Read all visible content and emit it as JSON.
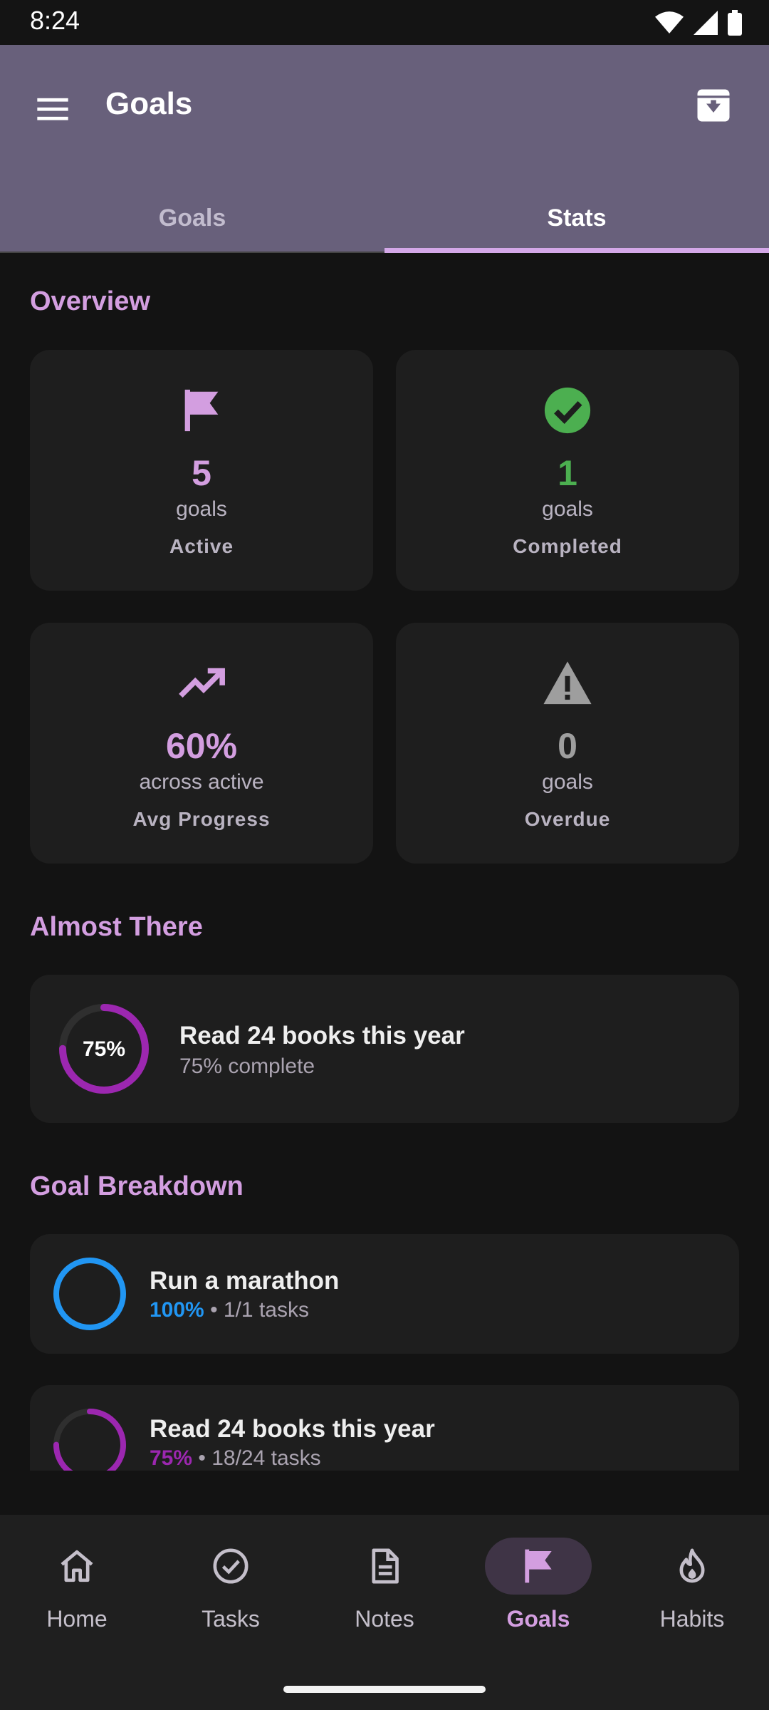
{
  "status": {
    "time": "8:24"
  },
  "appbar": {
    "title": "Goals"
  },
  "tabs": [
    {
      "label": "Goals"
    },
    {
      "label": "Stats"
    }
  ],
  "overview": {
    "title": "Overview",
    "cards": [
      {
        "value": "5",
        "unit": "goals",
        "caption": "Active",
        "icon": "flag-icon",
        "color": "#d39ee0"
      },
      {
        "value": "1",
        "unit": "goals",
        "caption": "Completed",
        "icon": "check-circle-icon",
        "color": "#4caf50"
      },
      {
        "value": "60%",
        "unit": "across active",
        "caption": "Avg Progress",
        "icon": "trending-up-icon",
        "color": "#d39ee0"
      },
      {
        "value": "0",
        "unit": "goals",
        "caption": "Overdue",
        "icon": "warning-icon",
        "color": "#9e9e9e"
      }
    ]
  },
  "almost_there": {
    "title": "Almost There",
    "item": {
      "percent_label": "75%",
      "progress": 0.75,
      "title": "Read 24 books this year",
      "subtitle": "75% complete",
      "color": "#9c27b0"
    }
  },
  "breakdown": {
    "title": "Goal Breakdown",
    "items": [
      {
        "title": "Run a marathon",
        "percent": "100%",
        "tasks": " • 1/1 tasks",
        "progress": 1.0,
        "color": "#2196f3"
      },
      {
        "title": "Read 24 books this year",
        "percent": "75%",
        "tasks": " • 18/24 tasks",
        "progress": 0.75,
        "color": "#9c27b0"
      }
    ]
  },
  "nav": [
    {
      "label": "Home",
      "icon": "home-icon"
    },
    {
      "label": "Tasks",
      "icon": "check-circle-outline-icon"
    },
    {
      "label": "Notes",
      "icon": "note-icon"
    },
    {
      "label": "Goals",
      "icon": "flag-icon",
      "active": true
    },
    {
      "label": "Habits",
      "icon": "flame-icon"
    }
  ]
}
